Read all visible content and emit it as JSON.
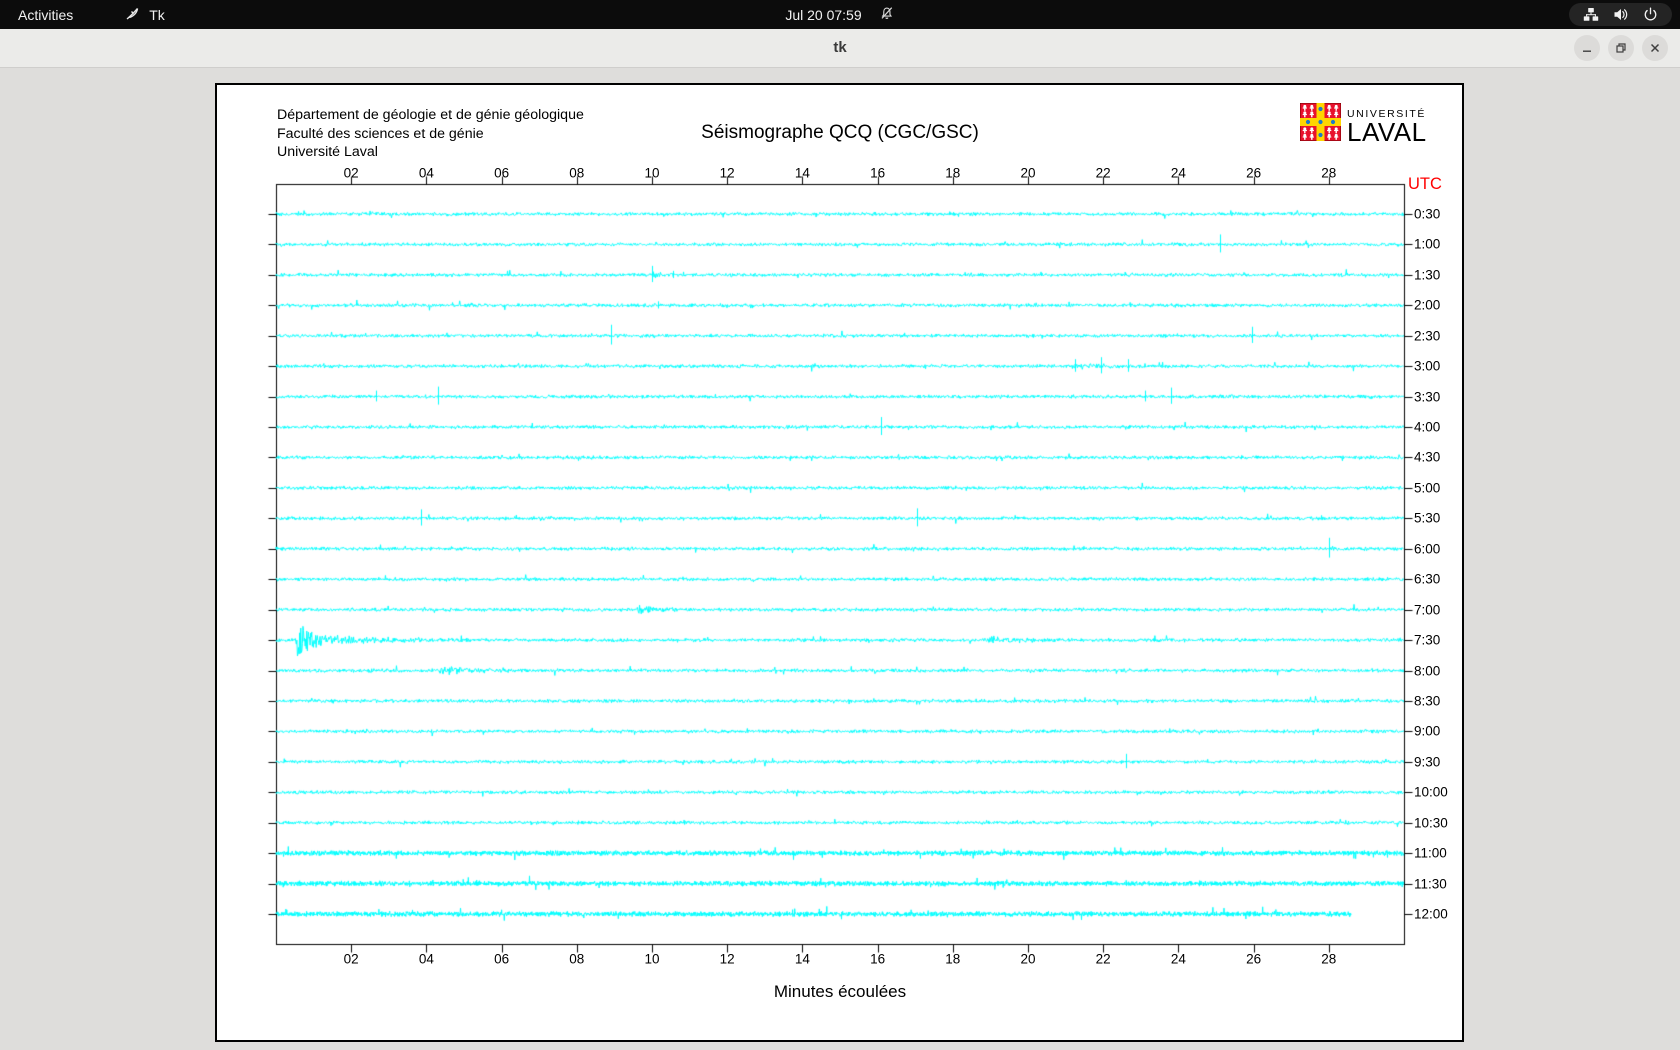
{
  "topbar": {
    "activities_label": "Activities",
    "app_name": "Tk",
    "clock": "Jul 20  07:59"
  },
  "window": {
    "title": "tk"
  },
  "chart": {
    "header_lines": [
      "Département de géologie et de génie géologique",
      "Faculté des sciences et de génie",
      "Université Laval"
    ],
    "title": "Séismographe QCQ (CGC/GSC)",
    "logo": {
      "small_text": "UNIVERSITÉ",
      "large_text": "LAVAL"
    },
    "utc_label": "UTC",
    "xlabel": "Minutes écoulées",
    "colors": {
      "trace": "#00ffff",
      "axis": "#000000",
      "utc_red": "#ff0000"
    },
    "chart_data": {
      "type": "line",
      "x_ticks": [
        "02",
        "04",
        "06",
        "08",
        "10",
        "12",
        "14",
        "16",
        "18",
        "20",
        "22",
        "24",
        "26",
        "28"
      ],
      "x_range_minutes": [
        0,
        30
      ],
      "rows": [
        {
          "time": "0:30",
          "events": []
        },
        {
          "time": "1:00",
          "events": [
            {
              "type": "spike",
              "min": 25.1,
              "amp": 10
            },
            {
              "type": "burst",
              "start": 19.3,
              "dur": 0.8,
              "amp": 2,
              "decay": 0.5
            }
          ]
        },
        {
          "time": "1:30",
          "events": [
            {
              "type": "spike",
              "min": 10.0,
              "amp": 9
            },
            {
              "type": "spike",
              "min": 10.55,
              "amp": 4
            },
            {
              "type": "burst",
              "start": 9.95,
              "dur": 1.0,
              "amp": 2,
              "decay": 0.6
            }
          ]
        },
        {
          "time": "2:00",
          "events": [
            {
              "type": "spike",
              "min": 10.15,
              "amp": 4
            }
          ]
        },
        {
          "time": "2:30",
          "events": [
            {
              "type": "spike",
              "min": 8.9,
              "amp": 11
            },
            {
              "type": "spike",
              "min": 25.95,
              "amp": 9
            }
          ]
        },
        {
          "time": "3:00",
          "events": [
            {
              "type": "spike",
              "min": 21.25,
              "amp": 7
            },
            {
              "type": "spike",
              "min": 21.95,
              "amp": 9
            },
            {
              "type": "spike",
              "min": 22.65,
              "amp": 7
            },
            {
              "type": "burst",
              "start": 21.0,
              "dur": 2.2,
              "amp": 2,
              "decay": 1.5
            }
          ]
        },
        {
          "time": "3:30",
          "events": [
            {
              "type": "spike",
              "min": 2.65,
              "amp": 6
            },
            {
              "type": "spike",
              "min": 4.3,
              "amp": 10
            },
            {
              "type": "spike",
              "min": 23.1,
              "amp": 6
            },
            {
              "type": "spike",
              "min": 23.8,
              "amp": 9
            }
          ]
        },
        {
          "time": "4:00",
          "events": [
            {
              "type": "spike",
              "min": 16.1,
              "amp": 10
            }
          ]
        },
        {
          "time": "4:30",
          "events": []
        },
        {
          "time": "5:00",
          "events": []
        },
        {
          "time": "5:30",
          "events": [
            {
              "type": "spike",
              "min": 3.85,
              "amp": 9
            },
            {
              "type": "spike",
              "min": 17.05,
              "amp": 10
            }
          ]
        },
        {
          "time": "6:00",
          "events": [
            {
              "type": "spike",
              "min": 28.0,
              "amp": 11
            }
          ]
        },
        {
          "time": "6:30",
          "events": []
        },
        {
          "time": "7:00",
          "events": [
            {
              "type": "burst",
              "start": 9.55,
              "dur": 1.2,
              "amp": 3.5,
              "decay": 0.9
            }
          ]
        },
        {
          "time": "7:30",
          "events": [
            {
              "type": "burst",
              "start": 0.5,
              "dur": 1.0,
              "amp": 22,
              "decay": 0.4
            },
            {
              "type": "burst",
              "start": 0.75,
              "dur": 5.5,
              "amp": 6,
              "decay": 2.0
            },
            {
              "type": "burst",
              "start": 18.9,
              "dur": 1.6,
              "amp": 3.5,
              "decay": 1.1
            }
          ]
        },
        {
          "time": "8:00",
          "events": [
            {
              "type": "burst",
              "start": 4.3,
              "dur": 1.4,
              "amp": 4.5,
              "decay": 1.0
            }
          ]
        },
        {
          "time": "8:30",
          "events": []
        },
        {
          "time": "9:00",
          "events": []
        },
        {
          "time": "9:30",
          "events": [
            {
              "type": "spike",
              "min": 22.6,
              "amp": 8
            }
          ]
        },
        {
          "time": "10:00",
          "events": []
        },
        {
          "time": "10:30",
          "events": []
        },
        {
          "time": "11:00",
          "events": [],
          "dense": true
        },
        {
          "time": "11:30",
          "events": [],
          "dense": true
        },
        {
          "time": "12:00",
          "events": [],
          "dense": true,
          "end_min": 28.6
        }
      ]
    }
  }
}
